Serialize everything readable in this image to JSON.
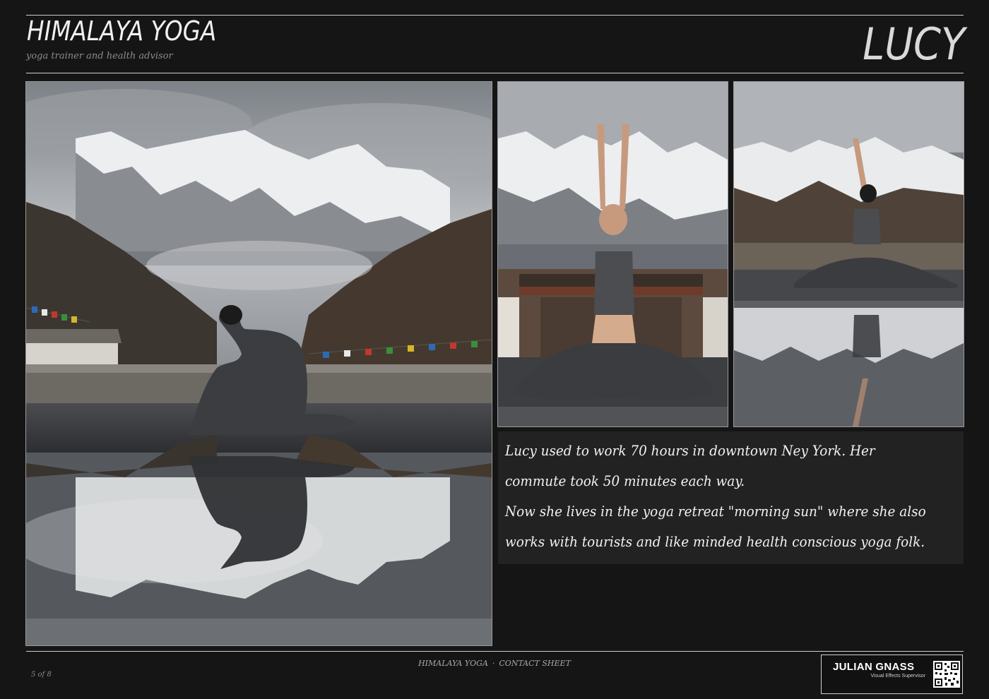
{
  "header": {
    "title": "HIMALAYA YOGA",
    "subtitle": "yoga trainer and health advisor",
    "name": "LUCY"
  },
  "caption": {
    "lines": [
      "Lucy used to work 70 hours in downtown Ney York. Her",
      "commute took 50 minutes each way.",
      "Now she lives in the yoga retreat \"morning sun\" where she also",
      "works with tourists and like minded health conscious yoga folk."
    ]
  },
  "footer": {
    "page": "5 of 8",
    "section": "HIMALAYA YOGA",
    "separator": "·",
    "sheet": "CONTACT SHEET",
    "badge_name": "JULIAN GNASS",
    "badge_role": "Visual Effects Supervisor"
  },
  "colors": {
    "background": "#151515",
    "rule": "#cfcfcf",
    "caption_bg": "#222222",
    "text": "#f2f2f2"
  },
  "icons": {
    "qr": "qr-code-icon"
  }
}
